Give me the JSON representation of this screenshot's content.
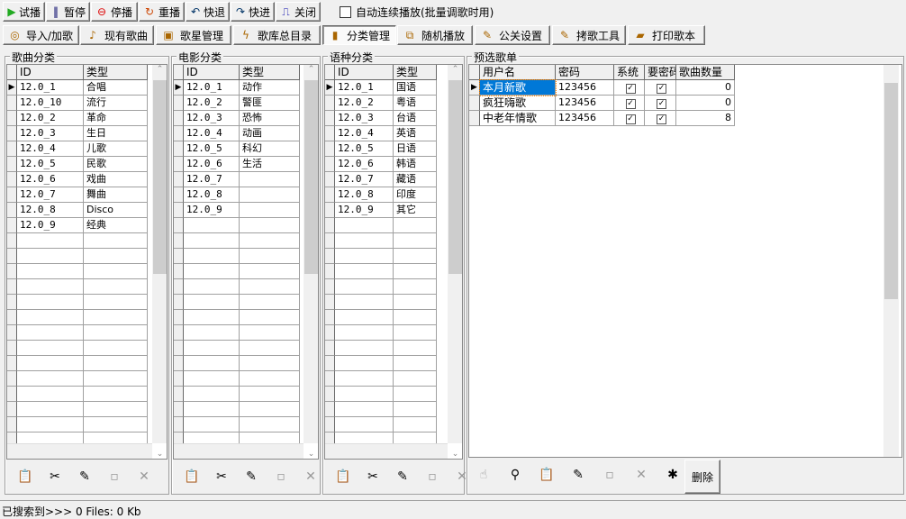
{
  "toolbar": [
    {
      "label": "试播",
      "icon": "play-icon",
      "g": "▶",
      "c": "#2a2"
    },
    {
      "label": "暂停",
      "icon": "pause-icon",
      "g": "‖",
      "c": "#006"
    },
    {
      "label": "停播",
      "icon": "stop-icon",
      "g": "⊖",
      "c": "#d00"
    },
    {
      "label": "重播",
      "icon": "replay-icon",
      "g": "↻",
      "c": "#c40"
    },
    {
      "label": "快退",
      "icon": "rewind-icon",
      "g": "↶",
      "c": "#036"
    },
    {
      "label": "快进",
      "icon": "forward-icon",
      "g": "↷",
      "c": "#036"
    },
    {
      "label": "关闭",
      "icon": "exit-door-icon",
      "g": "⎍",
      "c": "#00a"
    }
  ],
  "auto_play_label": "自动连续播放(批量调歌时用)",
  "tabs": [
    {
      "label": "导入/加歌",
      "icon": "cd-icon",
      "g": "◎"
    },
    {
      "label": "现有歌曲",
      "icon": "notes-icon",
      "g": "♪"
    },
    {
      "label": "歌星管理",
      "icon": "portrait-icon",
      "g": "▣"
    },
    {
      "label": "歌库总目录",
      "icon": "lightning-icon",
      "g": "ϟ"
    },
    {
      "label": "分类管理",
      "icon": "books-icon",
      "g": "▮",
      "active": true
    },
    {
      "label": "随机播放",
      "icon": "random-icon",
      "g": "⧉"
    },
    {
      "label": "公关设置",
      "icon": "brush-icon",
      "g": "✎"
    },
    {
      "label": "拷歌工具",
      "icon": "brush-icon",
      "g": "✎"
    },
    {
      "label": "打印歌本",
      "icon": "book-icon",
      "g": "▰"
    }
  ],
  "panels": [
    {
      "title": "歌曲分类",
      "headers": [
        "ID",
        "类型"
      ],
      "rows": [
        [
          "12.0_1",
          "合唱"
        ],
        [
          "12.0_10",
          "流行"
        ],
        [
          "12.0_2",
          "革命"
        ],
        [
          "12.0_3",
          "生日"
        ],
        [
          "12.0_4",
          "儿歌"
        ],
        [
          "12.0_5",
          "民歌"
        ],
        [
          "12.0_6",
          "戏曲"
        ],
        [
          "12.0_7",
          "舞曲"
        ],
        [
          "12.0_8",
          "Disco"
        ],
        [
          "12.0_9",
          "经典"
        ]
      ]
    },
    {
      "title": "电影分类",
      "headers": [
        "ID",
        "类型"
      ],
      "rows": [
        [
          "12.0_1",
          "动作"
        ],
        [
          "12.0_2",
          "警匪"
        ],
        [
          "12.0_3",
          "恐怖"
        ],
        [
          "12.0_4",
          "动画"
        ],
        [
          "12.0_5",
          "科幻"
        ],
        [
          "12.0_6",
          "生活"
        ],
        [
          "12.0_7",
          ""
        ],
        [
          "12.0_8",
          ""
        ],
        [
          "12.0_9",
          ""
        ]
      ]
    },
    {
      "title": "语种分类",
      "headers": [
        "ID",
        "类型"
      ],
      "rows": [
        [
          "12.0_1",
          "国语"
        ],
        [
          "12.0_2",
          "粤语"
        ],
        [
          "12.0_3",
          "台语"
        ],
        [
          "12.0_4",
          "英语"
        ],
        [
          "12.0_5",
          "日语"
        ],
        [
          "12.0_6",
          "韩语"
        ],
        [
          "12.0_7",
          "藏语"
        ],
        [
          "12.0_8",
          "印度"
        ],
        [
          "12.0_9",
          "其它"
        ]
      ]
    }
  ],
  "playlist": {
    "title": "预选歌单",
    "headers": [
      "用户名",
      "密码",
      "系统",
      "要密码",
      "歌曲数量"
    ],
    "rows": [
      [
        "本月新歌",
        "123456",
        true,
        true,
        "0"
      ],
      [
        "疯狂嗨歌",
        "123456",
        true,
        true,
        "0"
      ],
      [
        "中老年情歌",
        "123456",
        true,
        true,
        "8"
      ]
    ],
    "delete_label": "删除"
  },
  "status": "已搜索到>>> 0 Files: 0 Kb"
}
